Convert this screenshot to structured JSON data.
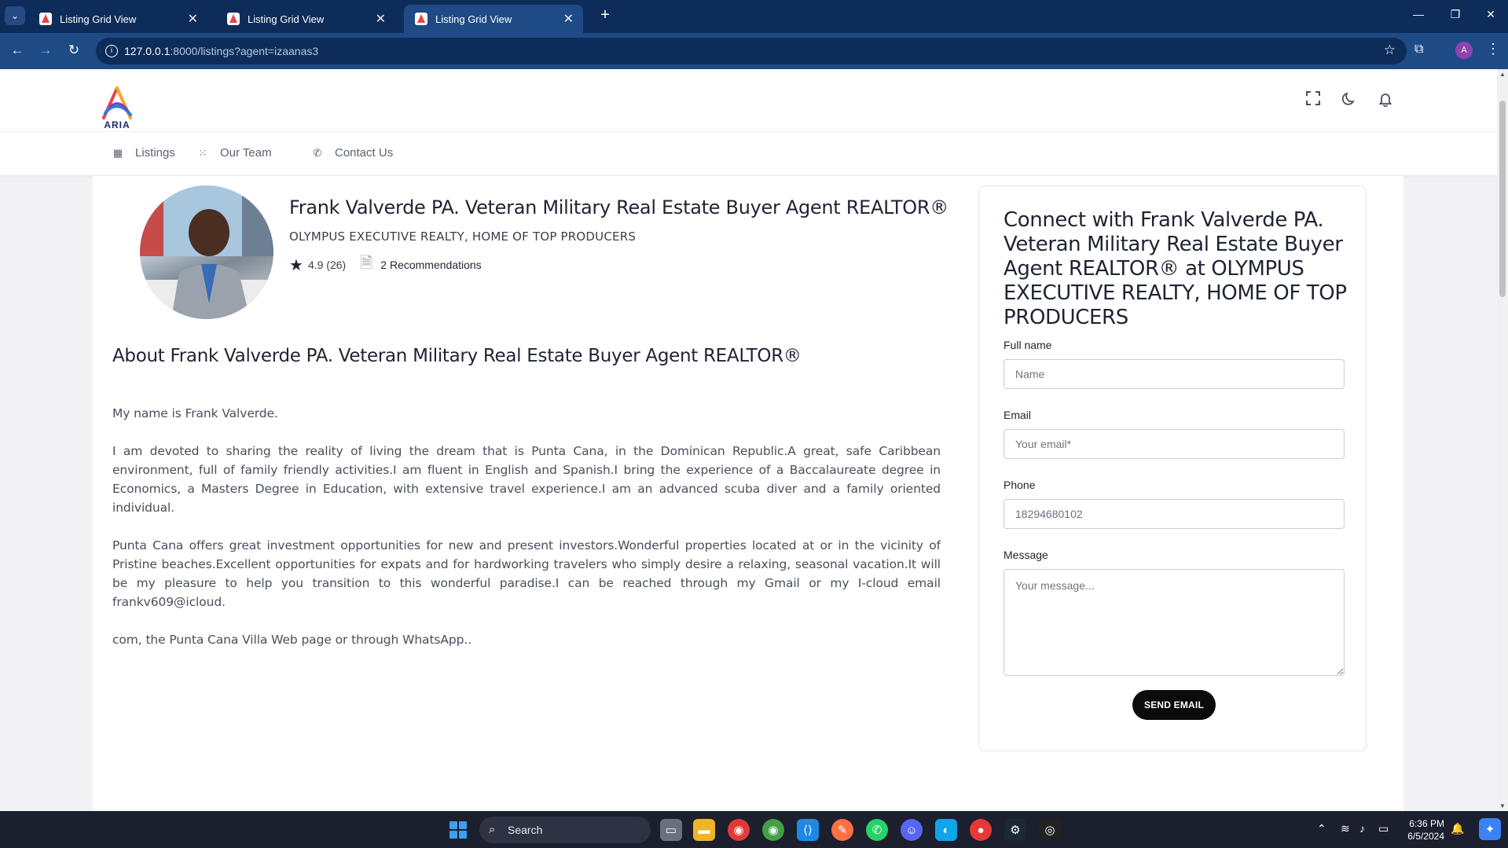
{
  "browser": {
    "tabs": [
      {
        "title": "Listing Grid View",
        "active": false
      },
      {
        "title": "Listing Grid View",
        "active": false
      },
      {
        "title": "Listing Grid View",
        "active": true
      }
    ],
    "new_tab_glyph": "+",
    "url_host": "127.0.0.1",
    "url_path": ":8000/listings?agent=izaanas3",
    "profile_initial": "A"
  },
  "header": {
    "logo_text": "ARIA",
    "icons": [
      "fullscreen-icon",
      "dark-mode-icon",
      "bell-icon"
    ]
  },
  "nav": {
    "items": [
      {
        "label": "Listings",
        "icon": "building-icon"
      },
      {
        "label": "Our Team",
        "icon": "grid-icon"
      },
      {
        "label": "Contact Us",
        "icon": "phone-icon"
      }
    ]
  },
  "agent": {
    "name": "Frank Valverde PA. Veteran Military Real Estate Buyer Agent REALTOR®",
    "agency": "OLYMPUS EXECUTIVE REALTY, HOME OF TOP PRODUCERS",
    "rating": "4.9 (26)",
    "recommendations": "2 Recommendations"
  },
  "about": {
    "heading": "About Frank Valverde PA. Veteran Military Real Estate Buyer Agent REALTOR®",
    "paragraphs": [
      "My name is Frank Valverde.",
      "I am devoted to sharing the reality of living the dream that is Punta Cana, in the Dominican Republic.A great, safe Caribbean environment, full of family friendly activities.I am fluent in English and Spanish.I bring the experience of a Baccalaureate degree in Economics, a Masters Degree in Education, with extensive travel experience.I am an advanced scuba diver and a family oriented individual.",
      "Punta Cana offers great investment opportunities for new and present investors.Wonderful properties located at or in the vicinity of Pristine beaches.Excellent opportunities for expats and for hardworking travelers who simply desire a relaxing, seasonal vacation.It will be my pleasure to help you transition to this wonderful paradise.I can be reached through my Gmail or my I-cloud email frankv609@icloud.",
      "com, the Punta Cana Villa Web page or through WhatsApp.."
    ]
  },
  "contact_form": {
    "title": "Connect with Frank Valverde PA. Veteran Military Real Estate Buyer Agent REALTOR® at OLYMPUS EXECUTIVE REALTY, HOME OF TOP PRODUCERS",
    "full_name_label": "Full name",
    "full_name_placeholder": "Name",
    "email_label": "Email",
    "email_placeholder": "Your email*",
    "phone_label": "Phone",
    "phone_value": "18294680102",
    "message_label": "Message",
    "message_placeholder": "Your message...",
    "submit_label": "SEND EMAIL"
  },
  "taskbar": {
    "search_label": "Search",
    "time": "6:36 PM",
    "date": "6/5/2024"
  }
}
